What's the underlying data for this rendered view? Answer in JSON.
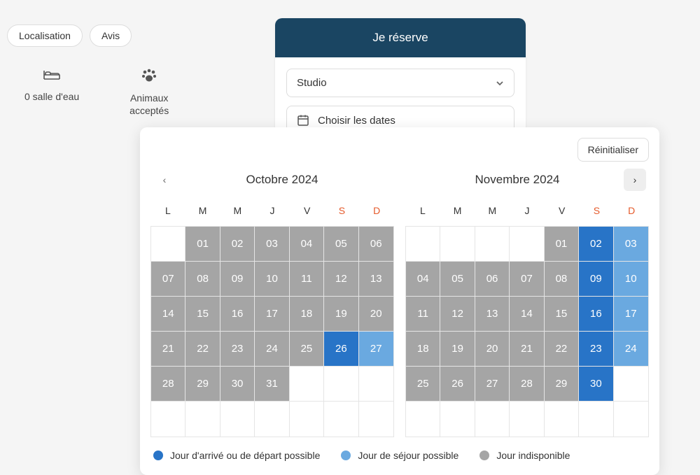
{
  "tabs": {
    "localisation": "Localisation",
    "avis": "Avis"
  },
  "features": {
    "bathroom": "0 salle d'eau",
    "pets": "Animaux acceptés"
  },
  "booking": {
    "title": "Je réserve",
    "unit": "Studio",
    "dates_label": "Choisir les dates"
  },
  "calendar": {
    "reset": "Réinitialiser",
    "prev": "‹",
    "next": "›",
    "months": [
      {
        "title": "Octobre 2024",
        "offset": 1,
        "days": [
          {
            "n": "01",
            "s": "unavailable"
          },
          {
            "n": "02",
            "s": "unavailable"
          },
          {
            "n": "03",
            "s": "unavailable"
          },
          {
            "n": "04",
            "s": "unavailable"
          },
          {
            "n": "05",
            "s": "unavailable"
          },
          {
            "n": "06",
            "s": "unavailable"
          },
          {
            "n": "07",
            "s": "unavailable"
          },
          {
            "n": "08",
            "s": "unavailable"
          },
          {
            "n": "09",
            "s": "unavailable"
          },
          {
            "n": "10",
            "s": "unavailable"
          },
          {
            "n": "11",
            "s": "unavailable"
          },
          {
            "n": "12",
            "s": "unavailable"
          },
          {
            "n": "13",
            "s": "unavailable"
          },
          {
            "n": "14",
            "s": "unavailable"
          },
          {
            "n": "15",
            "s": "unavailable"
          },
          {
            "n": "16",
            "s": "unavailable"
          },
          {
            "n": "17",
            "s": "unavailable"
          },
          {
            "n": "18",
            "s": "unavailable"
          },
          {
            "n": "19",
            "s": "unavailable"
          },
          {
            "n": "20",
            "s": "unavailable"
          },
          {
            "n": "21",
            "s": "unavailable"
          },
          {
            "n": "22",
            "s": "unavailable"
          },
          {
            "n": "23",
            "s": "unavailable"
          },
          {
            "n": "24",
            "s": "unavailable"
          },
          {
            "n": "25",
            "s": "unavailable"
          },
          {
            "n": "26",
            "s": "arrival"
          },
          {
            "n": "27",
            "s": "stay"
          },
          {
            "n": "28",
            "s": "unavailable"
          },
          {
            "n": "29",
            "s": "unavailable"
          },
          {
            "n": "30",
            "s": "unavailable"
          },
          {
            "n": "31",
            "s": "unavailable"
          }
        ]
      },
      {
        "title": "Novembre 2024",
        "offset": 4,
        "days": [
          {
            "n": "01",
            "s": "unavailable"
          },
          {
            "n": "02",
            "s": "arrival"
          },
          {
            "n": "03",
            "s": "stay"
          },
          {
            "n": "04",
            "s": "unavailable"
          },
          {
            "n": "05",
            "s": "unavailable"
          },
          {
            "n": "06",
            "s": "unavailable"
          },
          {
            "n": "07",
            "s": "unavailable"
          },
          {
            "n": "08",
            "s": "unavailable"
          },
          {
            "n": "09",
            "s": "arrival"
          },
          {
            "n": "10",
            "s": "stay"
          },
          {
            "n": "11",
            "s": "unavailable"
          },
          {
            "n": "12",
            "s": "unavailable"
          },
          {
            "n": "13",
            "s": "unavailable"
          },
          {
            "n": "14",
            "s": "unavailable"
          },
          {
            "n": "15",
            "s": "unavailable"
          },
          {
            "n": "16",
            "s": "arrival"
          },
          {
            "n": "17",
            "s": "stay"
          },
          {
            "n": "18",
            "s": "unavailable"
          },
          {
            "n": "19",
            "s": "unavailable"
          },
          {
            "n": "20",
            "s": "unavailable"
          },
          {
            "n": "21",
            "s": "unavailable"
          },
          {
            "n": "22",
            "s": "unavailable"
          },
          {
            "n": "23",
            "s": "arrival"
          },
          {
            "n": "24",
            "s": "stay"
          },
          {
            "n": "25",
            "s": "unavailable"
          },
          {
            "n": "26",
            "s": "unavailable"
          },
          {
            "n": "27",
            "s": "unavailable"
          },
          {
            "n": "28",
            "s": "unavailable"
          },
          {
            "n": "29",
            "s": "unavailable"
          },
          {
            "n": "30",
            "s": "arrival"
          }
        ]
      }
    ],
    "dow": [
      "L",
      "M",
      "M",
      "J",
      "V",
      "S",
      "D"
    ],
    "legend": {
      "arrival": "Jour d'arrivé ou de départ possible",
      "stay": "Jour de séjour possible",
      "unavailable": "Jour indisponible"
    }
  }
}
